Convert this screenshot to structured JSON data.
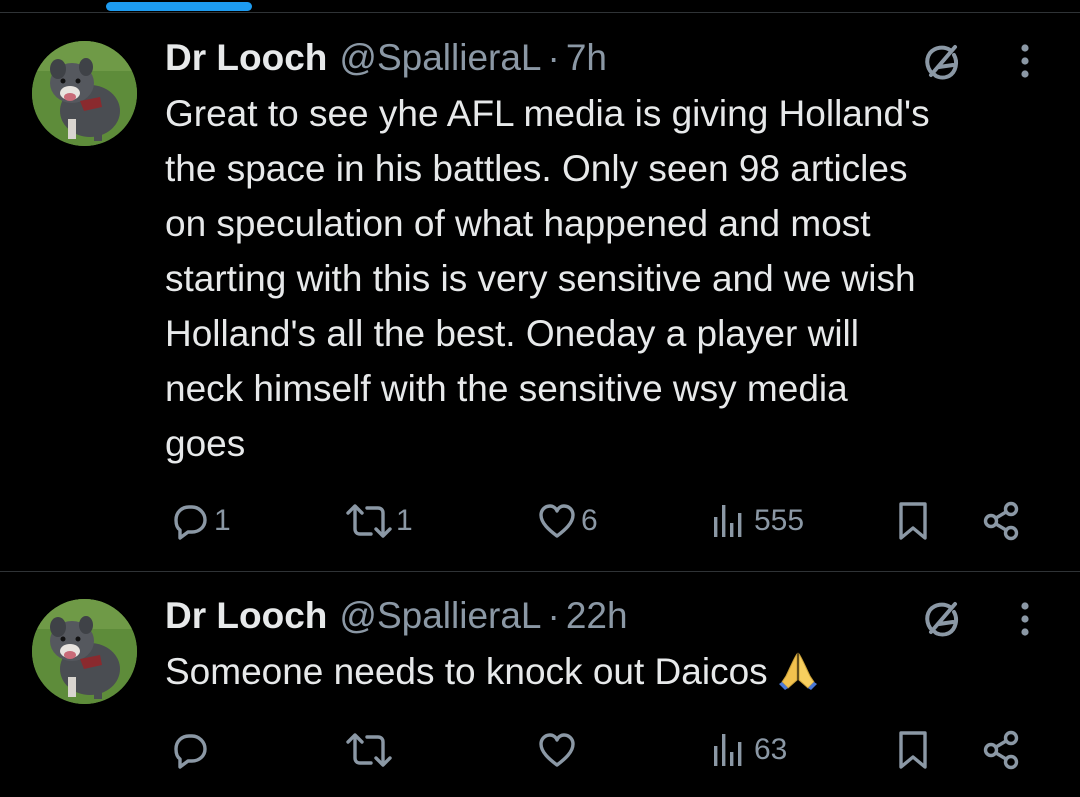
{
  "tweets": [
    {
      "display_name": "Dr Looch",
      "handle": "@SpallieraL",
      "separator": "·",
      "time": "7h",
      "text_lines": [
        "Great to see yhe AFL media is giving Holland's",
        "the space in his battles.  Only seen 98 articles",
        "on  speculation of what happened and most",
        "starting with this is very sensitive and we wish",
        "Holland's all the best. Oneday a player will",
        "neck himself with the sensitive wsy media",
        "goes"
      ],
      "replies": "1",
      "reposts": "1",
      "likes": "6",
      "views": "555"
    },
    {
      "display_name": "Dr Looch",
      "handle": "@SpallieraL",
      "separator": "·",
      "time": "22h",
      "text_lines": [
        "Someone needs to knock out Daicos"
      ],
      "emoji": "folded-hands",
      "replies": "",
      "reposts": "",
      "likes": "",
      "views": "63"
    }
  ],
  "icons": {
    "reply": "reply-icon",
    "repost": "repost-icon",
    "like": "heart-icon",
    "views": "views-icon",
    "bookmark": "bookmark-icon",
    "share": "share-icon",
    "grok": "grok-icon",
    "more": "more-icon"
  },
  "colors": {
    "background": "#000000",
    "text": "#e7e9ea",
    "muted": "#8b98a5",
    "divider": "#2f3336",
    "accent": "#1d9bf0"
  }
}
